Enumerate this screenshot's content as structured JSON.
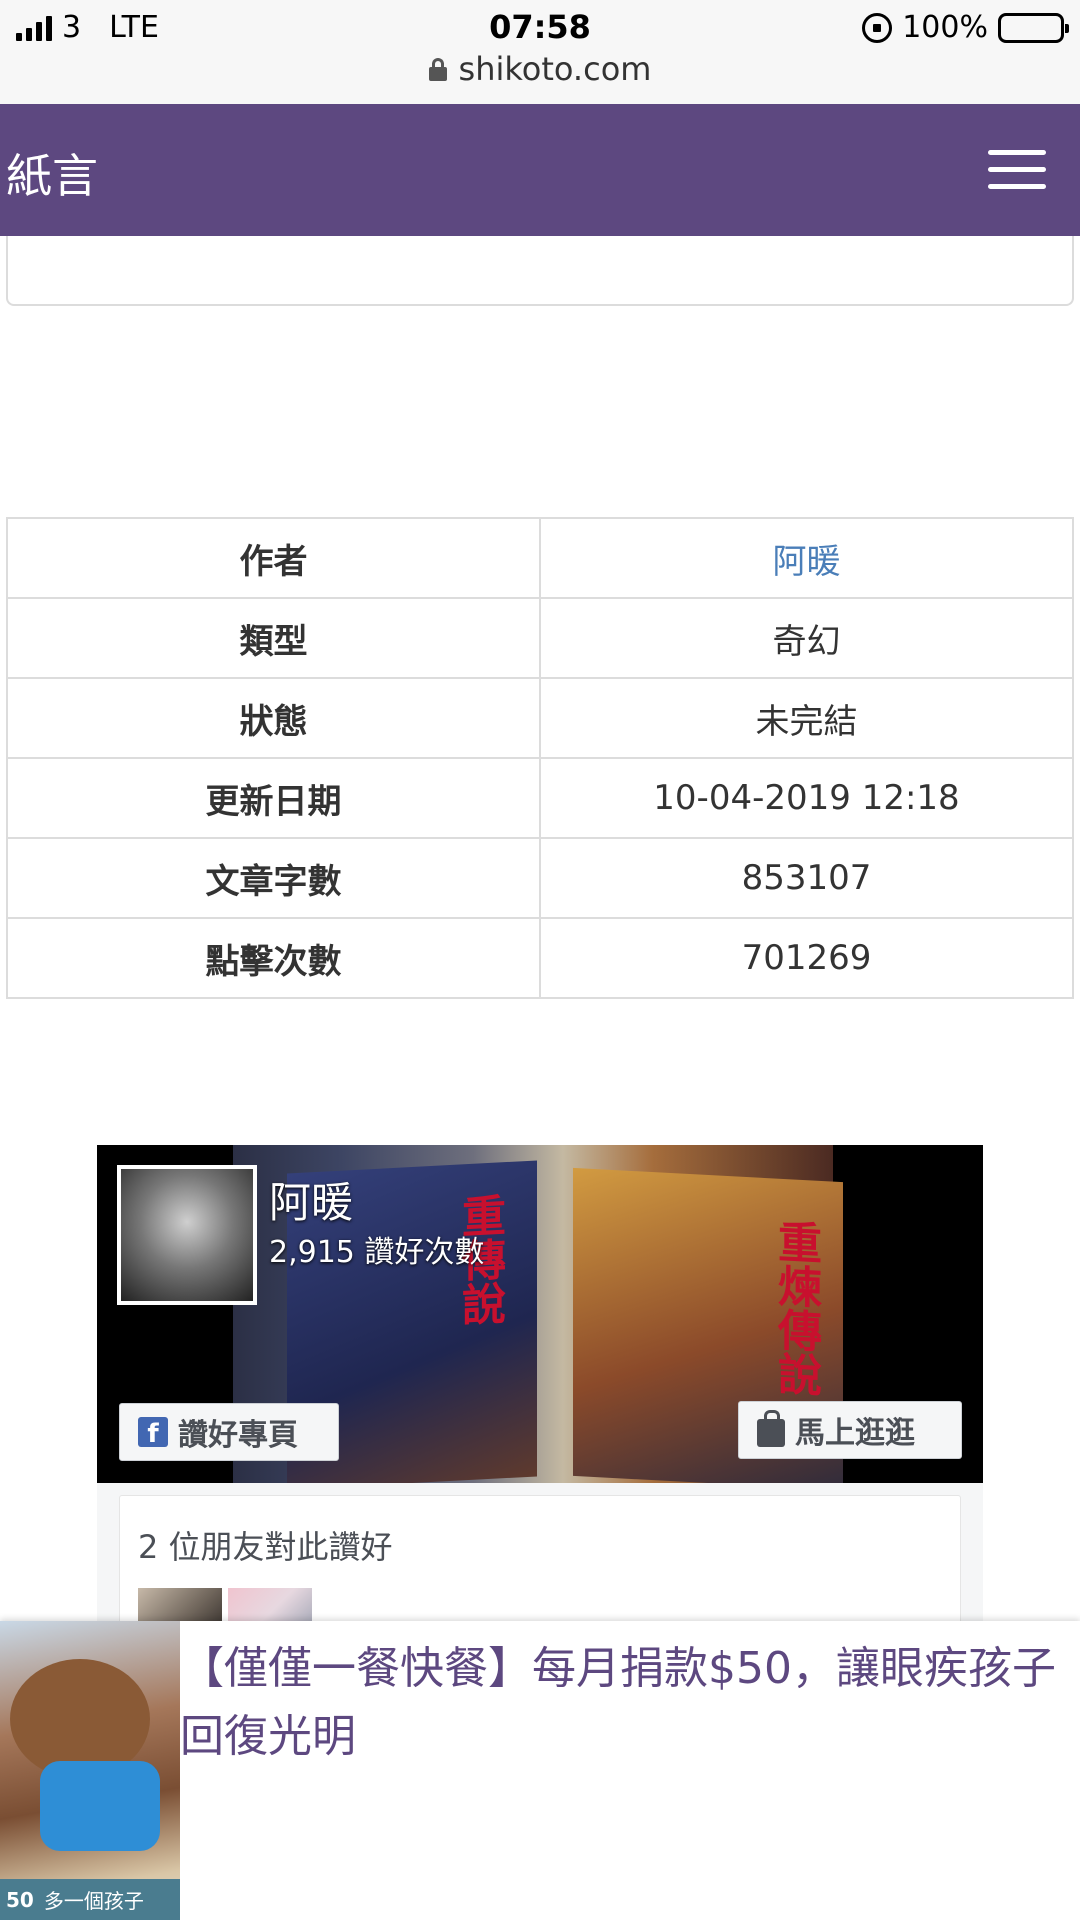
{
  "status_bar": {
    "carrier": "3",
    "network": "LTE",
    "time": "07:58",
    "battery": "100%",
    "url": "shikoto.com"
  },
  "navbar": {
    "brand": "紙言"
  },
  "info_table": {
    "rows": [
      {
        "label": "作者",
        "value": "阿暖"
      },
      {
        "label": "類型",
        "value": "奇幻"
      },
      {
        "label": "狀態",
        "value": "未完結"
      },
      {
        "label": "更新日期",
        "value": "10-04-2019 12:18"
      },
      {
        "label": "文章字數",
        "value": "853107"
      },
      {
        "label": "點擊次數",
        "value": "701269"
      }
    ]
  },
  "fb_widget": {
    "page_name": "阿暖",
    "likes": "2,915 讚好次數",
    "like_button": "讚好專頁",
    "shop_button": "馬上逛逛",
    "friends_text": "2 位朋友對此讚好",
    "book1_title": "重傳說",
    "book2_title": "重煉傳說"
  },
  "ad": {
    "title_line1": "【僅僅一餐快餐】每月捐款$50，讓眼疾孩子",
    "title_line2": "回復光明",
    "tag_amount": "50",
    "tag_text": "多一個孩子"
  },
  "colors": {
    "navbar": "#5d4880",
    "link": "#4a7eb8",
    "ad_title": "#5d4880"
  }
}
